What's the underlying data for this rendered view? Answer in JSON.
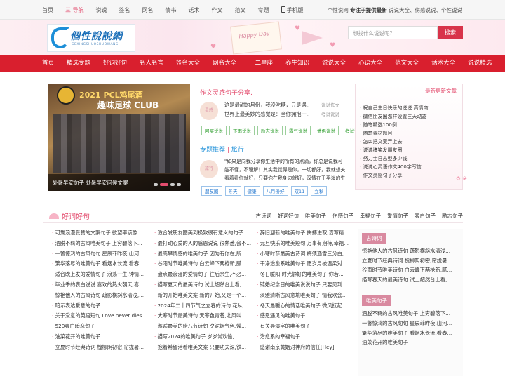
{
  "topnav": {
    "items": [
      "首页",
      "三 导航",
      "说说",
      "签名",
      "网名",
      "情书",
      "话术",
      "作文",
      "范文",
      "专题",
      "手机版"
    ],
    "right_prefix": "个性说网",
    "right_bold": "专注于提供最新",
    "right_suffix": "说说大全、伤感说说、个性说说"
  },
  "logo": {
    "name": "個性說說網",
    "sub": "GEXINGSHUOSHUOWANG"
  },
  "banner": {
    "card_text": "Happy Day"
  },
  "search": {
    "placeholder": "想找什么说说呢?",
    "button": "搜索"
  },
  "mainnav": [
    "首页",
    "精选专题",
    "好词好句",
    "名人名言",
    "签名大全",
    "网名大全",
    "十二星座",
    "养生知识",
    "说说大全",
    "心语大全",
    "范文大全",
    "话术大全",
    "说说精选"
  ],
  "slider": {
    "title1": "2021 PCL鸡尾酒",
    "title2": "趣味足球 CLUB",
    "caption": "处暑早安句子 处暑早安问候文案"
  },
  "article1": {
    "section": "作文灵感句子分享.",
    "avatar": "灵感",
    "text1": "这是最甜的月份，我没吃糖，只是遇...",
    "text2": "世界上最美妙的感觉是：当你拥抱一...",
    "meta1": "说说作文",
    "meta2": "考试说说",
    "tags": [
      "回买说说",
      "下雨说说",
      "励志说说",
      "霸气说说",
      "情侣说说",
      "考试说说"
    ]
  },
  "article2": {
    "section_a": "专题推荐",
    "section_sep": " | ",
    "section_b": "旅行",
    "avatar": "旅行",
    "text": [
      "\"如果是向我分享你生活中的所有的点滴，你总是说我可",
      "能不懂，不理解！其实我觉得是你，一切都好，我就想关",
      "看着看你就好，只要你在我身边就好，深情在于平淡的生"
    ],
    "tags": [
      "朋友圈",
      "冬天",
      "健康",
      "八月份好",
      "双11",
      "立秋"
    ]
  },
  "rightbox": {
    "title": "最新更新文章",
    "items": [
      "祝自己生日快乐的说说 高情商...",
      "微信朋友圈怎样设置三天动态",
      "随笔精选100例",
      "随笔素材题目",
      "怎么把文案弄上去",
      "说说搞笑发朋友圈",
      "努力士日志型多少钱",
      "说说心灵语作文400字写信",
      "作文灵感句子分享"
    ]
  },
  "section2": {
    "title": "好词好句",
    "tabs": [
      "古诗词",
      "好词好句",
      "唯美句子",
      "伤感句子",
      "幸福句子",
      "爱情句子",
      "表白句子",
      "励志句子"
    ]
  },
  "col1": [
    "可爱浪漫受赞的文案句子 欲望率该像...",
    "酒脱不羁的古风唯美句子 上穷碧落下...",
    "一瞥惊鸿的古风句句 星辰菲昨夜,山河...",
    "繁华落尽的唯美句子 看烟水长流,看春...",
    "适合晚上发的爱情句子 浪荡一生,钟情...",
    "毕业季的表白说说 喜欢的热火朝天,喜...",
    "惊艳他人的古风诗句 疏影横斜水清浅,...",
    "暗示表达爱意的句子",
    "关于爱意的英语短句 Love never dies",
    "520表白暗恋句子",
    "油菜花开的唯美句子",
    "立夏时节经典诗词 槐柳阴初密,帘拢暑..."
  ],
  "col2": [
    "适合发朋友圈美到极致很有意义的句子",
    "最打动心爱的人的感恩说说 很熟悉,会不...",
    "最高攀情感的唯美句子 因为有你在,所...",
    "谷雨时节唯美诗句 白云峰下两枪新,腻...",
    "盘点最浪漫的爱情句子 往后余生,不必...",
    "描写夏天的最美诗句 试上超然台上看,...",
    "新的开始唯美文案 新的开始,又是一个...",
    "2024年二十四节气之立春的诗句 花从...",
    "大寒时节最美诗句 天寒色青苍,北风叫...",
    "邂逅最美的腊八节诗句 夕泥烟气色,馍...",
    "描写2024的唯美句子 岁岁常欢愉,...",
    "抱着希望活着唯美文案 只要功夫深,铁..."
  ],
  "col3": [
    "辞旧迎新的唯美句子 拼搏进取,谱写精...",
    "元旦快乐的唯美短句 万事有期待,幸福...",
    "小寒时节最美古诗词 梅须遜雪三分白,...",
    "干净治愈系唯美句子 愿岁月被温柔对...",
    "冬日暖阳,时光静好的唯美句子 你若...",
    "链婚纪念日的唯美说说句子 只要见到...",
    "淡雅清晰古风意境唯美句子 情我欢会...",
    "冬天最暖心的情话唯美句子 微风抚起...",
    "感恩遇见的唯美句子",
    "有关导演字的唯美句子",
    "治愈系的幸福句子",
    "感谢南京黄姻对神府的信任[Hey]"
  ],
  "side": {
    "box1_title": "古诗词",
    "box1_items": [
      "惊艳他人的古风诗句 疏影横斜水清浅...",
      "立夏时节经典诗词 槐柳阴初密,帘拢暑...",
      "谷雨时节唯美诗句 白云峰下两枪新,腻...",
      "描写春天的最美诗句 试上超然台上看,..."
    ],
    "box2_title": "唯美句子",
    "box2_items": [
      "酒脱不羁的古风唯美句子 上穷碧落下...",
      "一瞥惊鸿的古风句句 星辰菲昨夜,山河...",
      "繁华落尽的唯美句子 看烟水长流,看春...",
      "油菜花开的唯美句子"
    ]
  },
  "colors": {
    "accent": "#d91f2e",
    "pink": "#e34c6e",
    "blue": "#1d8fd8"
  }
}
